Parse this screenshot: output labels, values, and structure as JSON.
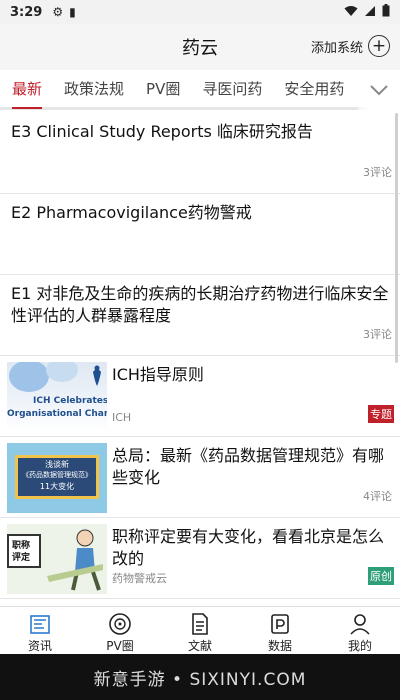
{
  "status_bar": {
    "time": "3:29"
  },
  "header": {
    "title": "药云",
    "add_system_label": "添加系统"
  },
  "tabs": [
    {
      "label": "最新",
      "active": true
    },
    {
      "label": "政策法规",
      "active": false
    },
    {
      "label": "PV圈",
      "active": false
    },
    {
      "label": "寻医问药",
      "active": false
    },
    {
      "label": "安全用药",
      "active": false
    }
  ],
  "feed": [
    {
      "title": "E3 Clinical Study Reports 临床研究报告",
      "comments": "3评论"
    },
    {
      "title": "E2 Pharmacovigilance药物警戒",
      "comments": ""
    },
    {
      "title": "E1 对非危及生命的疾病的长期治疗药物进行临床安全性评估的人群暴露程度",
      "comments": "3评论"
    }
  ],
  "media_items": [
    {
      "title": "ICH指导原则",
      "source": "ICH",
      "tag": "专题",
      "comments": "",
      "thumb_text_1": "ICH Celebrates",
      "thumb_text_2": "Organisational Changes"
    },
    {
      "title": "总局：最新《药品数据管理规范》有哪些变化",
      "source": "",
      "tag": "",
      "comments": "4评论",
      "thumb_text_1": "浅谈新",
      "thumb_text_2": "《药品数据管理规范》",
      "thumb_text_3": "11大变化"
    },
    {
      "title": "职称评定要有大变化，看看北京是怎么改的",
      "source": "药物警戒云",
      "tag": "原创",
      "comments": "",
      "thumb_text_1": "职称",
      "thumb_text_2": "评定"
    }
  ],
  "bottom_nav": [
    {
      "label": "资讯",
      "icon": "news-icon"
    },
    {
      "label": "PV圈",
      "icon": "pv-circle-icon"
    },
    {
      "label": "文献",
      "icon": "document-icon"
    },
    {
      "label": "数据",
      "icon": "data-icon"
    },
    {
      "label": "我的",
      "icon": "person-icon"
    }
  ],
  "watermark": "新意手游 • SIXINYI.COM"
}
